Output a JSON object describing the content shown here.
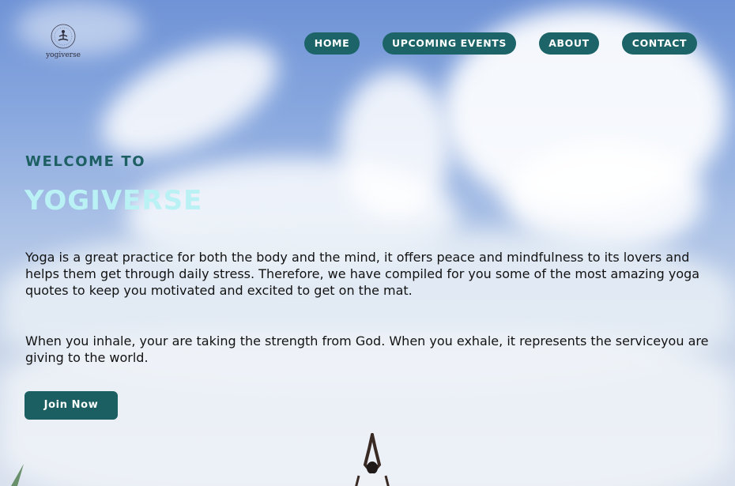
{
  "logo": {
    "text": "yogiverse"
  },
  "nav": {
    "items": [
      {
        "label": "HOME"
      },
      {
        "label": "UPCOMING EVENTS"
      },
      {
        "label": "ABOUT"
      },
      {
        "label": "CONTACT"
      }
    ]
  },
  "hero": {
    "welcome": "WELCOME TO",
    "brand": "YOGIVERSE",
    "paragraph1": "Yoga is a great practice for both the body and the mind, it offers peace and mindfulness to its lovers and helps them get through daily stress. Therefore, we have compiled for you some of the most amazing yoga quotes to keep you motivated and excited to get on the mat.",
    "paragraph2": "When you inhale, your are taking the strength from God. When you exhale, it represents the serviceyou are giving to the world.",
    "cta": "Join Now"
  },
  "colors": {
    "accent": "#1c6468",
    "brand_text": "#b9f1f4",
    "welcome_text": "#1d5f62"
  },
  "icons": {
    "logo": "meditation-figure-icon",
    "figure": "yoga-person-image"
  }
}
